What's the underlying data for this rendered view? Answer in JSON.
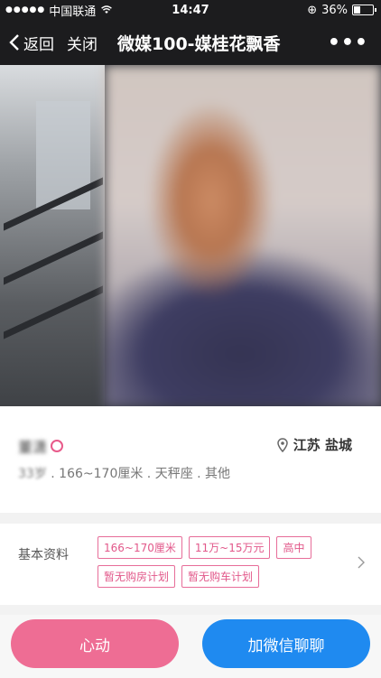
{
  "status": {
    "carrier": "中国联通",
    "time": "14:47",
    "battery": "36%"
  },
  "nav": {
    "back": "返回",
    "close": "关闭",
    "title": "微媒100-媒桂花飘香",
    "more": "•••"
  },
  "profile": {
    "name": "董潇",
    "location": "江苏 盐城",
    "meta_age": "33岁",
    "meta_rest": " . 166~170厘米 . 天秤座 . 其他"
  },
  "basic": {
    "label": "基本资料",
    "tags": [
      "166~170厘米",
      "11万~15万元",
      "高中",
      "暂无购房计划",
      "暂无购车计划"
    ]
  },
  "actions": {
    "heart": "心动",
    "wechat": "加微信聊聊"
  },
  "colors": {
    "pink": "#ee6d94",
    "blue": "#1f8af0",
    "tag": "#e76d99"
  }
}
